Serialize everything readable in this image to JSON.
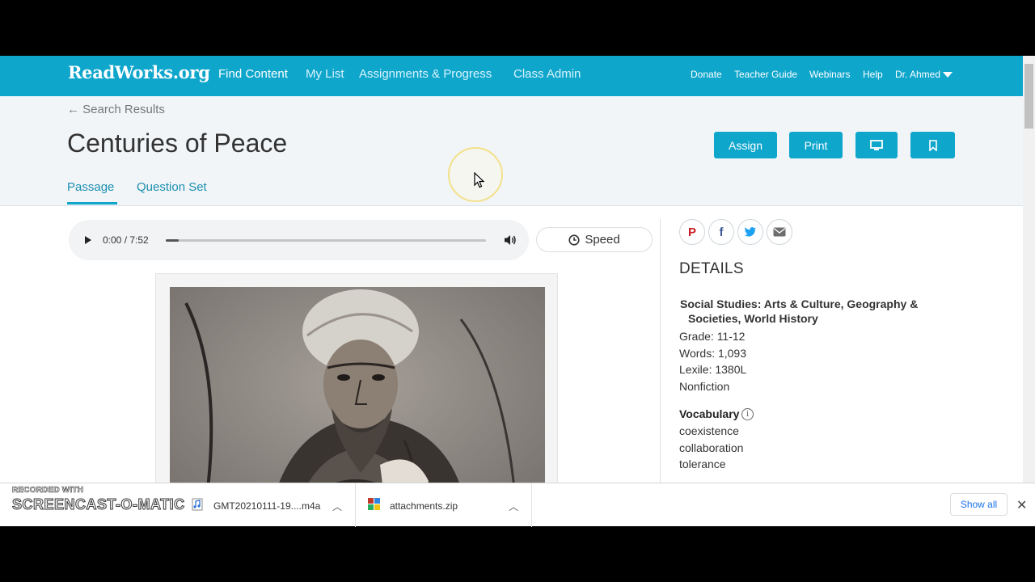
{
  "nav": {
    "logo": "ReadWorks.org",
    "main": [
      "Find Content",
      "My List",
      "Assignments & Progress",
      "Class Admin"
    ],
    "secondary": [
      "Donate",
      "Teacher Guide",
      "Webinars",
      "Help",
      "Dr. Ahmed"
    ]
  },
  "header": {
    "back": "← Search Results",
    "title": "Centuries of Peace",
    "assign": "Assign",
    "print": "Print",
    "tabs": [
      "Passage",
      "Question Set"
    ]
  },
  "audio": {
    "time": "0:00 / 7:52",
    "progress": 0.04
  },
  "speed_label": "Speed",
  "details": {
    "heading": "DETAILS",
    "subject_line1": "Social Studies: Arts & Culture, Geography &",
    "subject_line2": "Societies, World History",
    "grade": "Grade: 11-12",
    "words": "Words: 1,093",
    "lexile": "Lexile: 1380L",
    "type": "Nonfiction",
    "vocab_heading": "Vocabulary",
    "vocab": [
      "coexistence",
      "collaboration",
      "tolerance"
    ]
  },
  "downloads": {
    "recorded": "RECORDED WITH",
    "brand": "SCREENCAST-O-MATIC",
    "items": [
      "GMT20210111-19....m4a",
      "attachments.zip"
    ],
    "show_all": "Show all"
  },
  "colors": {
    "brand": "#0fa6cc"
  }
}
